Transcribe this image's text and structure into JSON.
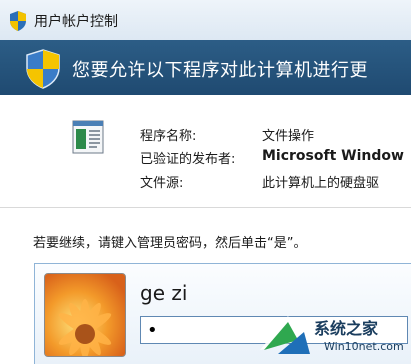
{
  "window": {
    "title": "用户帐户控制"
  },
  "banner": {
    "text": "您要允许以下程序对此计算机进行更"
  },
  "program_info": {
    "rows": [
      {
        "label": "程序名称:",
        "value": "文件操作"
      },
      {
        "label": "已验证的发布者:",
        "value": "Microsoft Window"
      },
      {
        "label": "文件源:",
        "value": "此计算机上的硬盘驱"
      }
    ]
  },
  "prompt": {
    "instruction": "若要继续，请键入管理员密码，然后单击“是”。"
  },
  "credentials": {
    "username": "ge zi",
    "password_value": "•"
  },
  "watermark": {
    "line1": "系统之家",
    "line2": "Win10net.com"
  },
  "colors": {
    "banner_bg": "#1f4a71",
    "titlebar_bg": "#dde8f3",
    "accent_border": "#8fb4d7"
  },
  "icons": {
    "title_icon": "uac-shield-icon",
    "banner_icon": "uac-shield-icon",
    "program_icon": "file-operation-icon",
    "avatar": "orange-flower-avatar"
  }
}
